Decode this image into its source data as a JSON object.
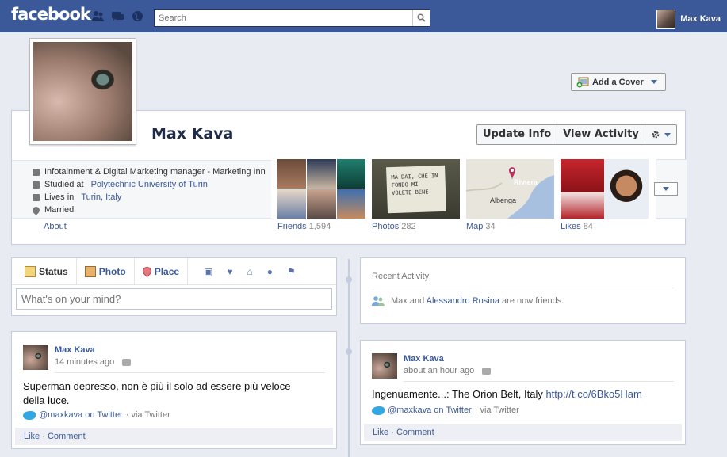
{
  "topbar": {
    "logo": "facebook",
    "search_placeholder": "Search",
    "user_name": "Max Kava"
  },
  "cover": {
    "add_cover_label": "Add a Cover"
  },
  "profile": {
    "name": "Max Kava",
    "update_info": "Update Info",
    "view_activity": "View Activity",
    "info": [
      {
        "text": "Infotainment & Digital Marketing manager - Marketing Inn"
      },
      {
        "prefix": "Studied at ",
        "link": "Polytechnic University of Turin"
      },
      {
        "prefix": "Lives in ",
        "link": "Turin, Italy"
      },
      {
        "text": "Married"
      }
    ],
    "about": "About",
    "tiles": {
      "friends": {
        "label": "Friends",
        "count": "1,594"
      },
      "photos": {
        "label": "Photos",
        "count": "282",
        "note_text": "MA DAI, CHE IN FONDO MI VOLETE BENE"
      },
      "map": {
        "label": "Map",
        "count": "34",
        "place": "Albenga",
        "region": "Riviera"
      },
      "likes": {
        "label": "Likes",
        "count": "84"
      }
    }
  },
  "composer": {
    "tabs": [
      "Status",
      "Photo",
      "Place"
    ],
    "placeholder": "What's on your mind?"
  },
  "recent_activity": {
    "title": "Recent Activity",
    "actor": "Max",
    "and": " and ",
    "friend": "Alessandro Rosina",
    "suffix": " are now friends."
  },
  "posts": [
    {
      "author": "Max Kava",
      "time": "14 minutes ago",
      "text": "Superman depresso, non è più il solo ad essere più veloce della luce.",
      "via_user": "@maxkava on Twitter",
      "via_source": "· via Twitter",
      "like": "Like",
      "comment": "Comment"
    },
    {
      "author": "Max Kava",
      "time": "about an hour ago",
      "text": "Ingenuamente...: The Orion Belt, Italy ",
      "link": "http://t.co/6Bko5Ham",
      "via_user": "@maxkava on Twitter",
      "via_source": "· via Twitter",
      "like": "Like",
      "comment": "Comment"
    }
  ],
  "colors": {
    "brand": "#3b5998",
    "background": "#e9ebf2",
    "border": "#c4cde0"
  }
}
